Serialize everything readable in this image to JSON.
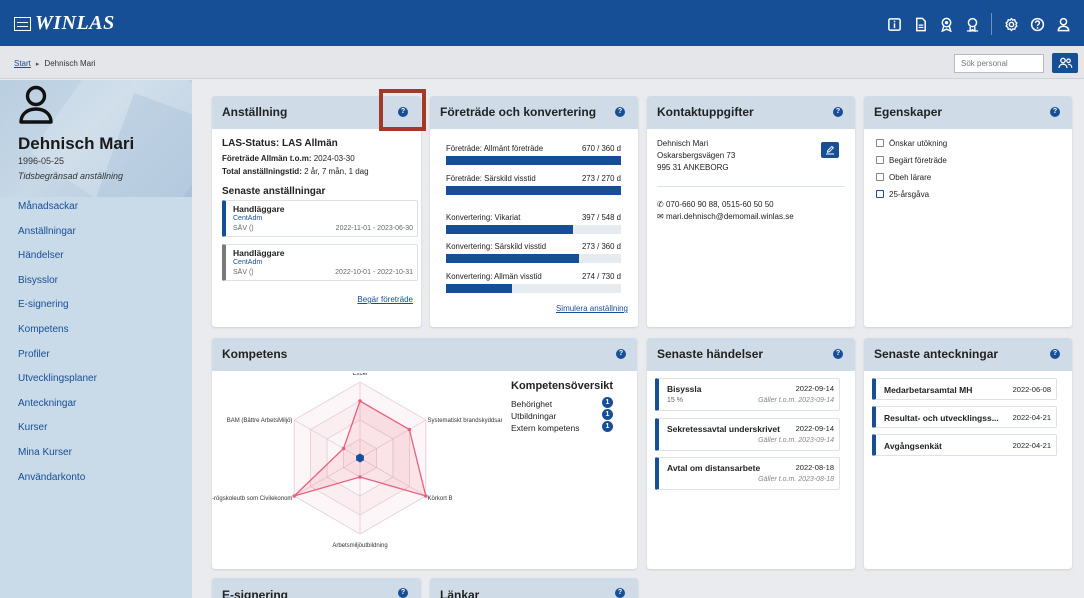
{
  "app": {
    "title": "WINLAS"
  },
  "breadcrumb": {
    "start": "Start",
    "current": "Dehnisch Mari"
  },
  "search": {
    "placeholder": "Sök personal"
  },
  "profile": {
    "name": "Dehnisch Mari",
    "birthdate": "1996-05-25",
    "employment_type": "Tidsbegränsad anställning"
  },
  "sidebar": {
    "items": [
      {
        "label": "Månadsackar"
      },
      {
        "label": "Anställningar"
      },
      {
        "label": "Händelser"
      },
      {
        "label": "Bisysslor"
      },
      {
        "label": "E-signering"
      },
      {
        "label": "Kompetens"
      },
      {
        "label": "Profiler"
      },
      {
        "label": "Utvecklingsplaner"
      },
      {
        "label": "Anteckningar"
      },
      {
        "label": "Kurser"
      },
      {
        "label": "Mina Kurser"
      },
      {
        "label": "Användarkonto"
      }
    ]
  },
  "anstallning": {
    "title": "Anställning",
    "las_status": "LAS-Status: LAS Allmän",
    "foretrade_label": "Företräde Allmän t.o.m:",
    "foretrade_value": "2024-03-30",
    "total_label": "Total anställningstid:",
    "total_value": "2 år, 7 mån, 1 dag",
    "recent_title": "Senaste anställningar",
    "items": [
      {
        "role": "Handläggare",
        "unit": "CentAdm",
        "code": "SÄV ()",
        "period": "2022-11-01 - 2023-06-30"
      },
      {
        "role": "Handläggare",
        "unit": "CentAdm",
        "code": "SÄV ()",
        "period": "2022-10-01 - 2022-10-31"
      }
    ],
    "link": "Begär företräde"
  },
  "foretrade": {
    "title": "Företräde och konvertering",
    "rows": [
      {
        "label": "Företräde: Allmänt företräde",
        "value": "670 / 360 d",
        "fraction": 1.0
      },
      {
        "label": "Företräde: Särskild visstid",
        "value": "273 / 270 d",
        "fraction": 1.0
      },
      {
        "label": "Konvertering: Vikariat",
        "value": "397 / 548 d",
        "fraction": 0.724
      },
      {
        "label": "Konvertering: Särskild visstid",
        "value": "273 / 360 d",
        "fraction": 0.758
      },
      {
        "label": "Konvertering: Allmän visstid",
        "value": "274 / 730 d",
        "fraction": 0.375
      }
    ],
    "link": "Simulera anställning"
  },
  "kontakt": {
    "title": "Kontaktuppgifter",
    "name": "Dehnisch Mari",
    "street": "Oskarsbergsvägen 73",
    "city": "995 31 ANKEBORG",
    "phone": "070-660 90 88, 0515-60 50 50",
    "email": "mari.dehnisch@demomail.winlas.se"
  },
  "egenskaper": {
    "title": "Egenskaper",
    "items": [
      {
        "label": "Önskar utökning"
      },
      {
        "label": "Begärt företräde"
      },
      {
        "label": "Obeh lärare"
      },
      {
        "label": "25-årsgåva"
      }
    ]
  },
  "kompetens": {
    "title": "Kompetens",
    "overview_title": "Kompetensöversikt",
    "overview": [
      {
        "label": "Behörighet",
        "count": "1"
      },
      {
        "label": "Utbildningar",
        "count": "1"
      },
      {
        "label": "Extern kompetens",
        "count": "1"
      }
    ]
  },
  "chart_data": {
    "type": "radar",
    "axes": [
      "Excel",
      "Systematiskt brandskyddsarb",
      "Körkort B",
      "Arbetsmiljöutbildning",
      "Högskoleutb som Civilekonom",
      "BAM (Bättre ArbetsMiljö)"
    ],
    "axis_label_text": [
      "Excel",
      "Systematiskt brandskyddsarb",
      "Körkort B",
      "Arbetsmiljöutbildning",
      "-rögskoleutb som Civilekonom",
      "BAM (Bättre ArbetsMiljö)"
    ],
    "levels": 4,
    "range": [
      0,
      4
    ],
    "series": [
      {
        "values": [
          3,
          3,
          4,
          1,
          4,
          1
        ]
      }
    ],
    "grid": true
  },
  "handelser": {
    "title": "Senaste händelser",
    "items": [
      {
        "title": "Bisyssla",
        "date": "2022-09-14",
        "sub": "15 %",
        "valid": "Gäller t.o.m. 2023-09-14"
      },
      {
        "title": "Sekretessavtal underskrivet",
        "date": "2022-09-14",
        "sub": "",
        "valid": "Gäller t.o.m. 2023-09-14"
      },
      {
        "title": "Avtal om distansarbete",
        "date": "2022-08-18",
        "sub": "",
        "valid": "Gäller t.o.m. 2023-08-18"
      }
    ]
  },
  "anteckningar": {
    "title": "Senaste anteckningar",
    "items": [
      {
        "title": "Medarbetarsamtal MH",
        "date": "2022-06-08"
      },
      {
        "title": "Resultat- och utvecklingss...",
        "date": "2022-04-21"
      },
      {
        "title": "Avgångsenkät",
        "date": "2022-04-21"
      }
    ]
  },
  "esignering": {
    "title": "E-signering"
  },
  "lankar": {
    "title": "Länkar"
  },
  "help_symbol": "?",
  "colors": {
    "brand": "#174f96",
    "header_card": "#cfdce8",
    "radar_line": "#e8607f",
    "highlight": "#a13a28"
  }
}
